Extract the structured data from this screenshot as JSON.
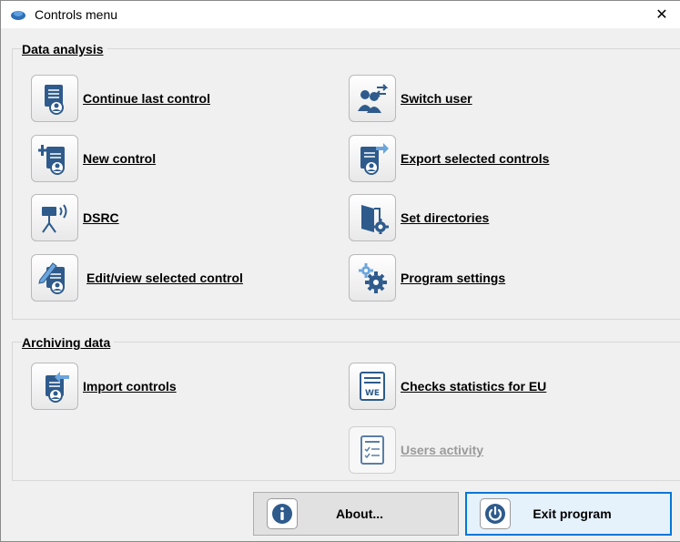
{
  "window": {
    "title": "Controls menu",
    "close_glyph": "✕"
  },
  "sections": {
    "data_analysis": "Data analysis",
    "archiving": "Archiving data"
  },
  "items": {
    "continue_last_control": {
      "label": "Continue last control",
      "icon": "document-user-icon"
    },
    "switch_user": {
      "label": "Switch user",
      "icon": "switch-user-icon"
    },
    "new_control": {
      "label": "New control",
      "icon": "new-document-icon"
    },
    "export_selected_controls": {
      "label": "Export selected controls",
      "icon": "export-document-icon"
    },
    "dsrc": {
      "label": "DSRC",
      "icon": "dsrc-antenna-icon"
    },
    "set_directories": {
      "label": "Set directories",
      "icon": "folder-gear-icon"
    },
    "edit_view_selected_control": {
      "label": "Edit/view selected control",
      "icon": "edit-document-icon"
    },
    "program_settings": {
      "label": "Program settings",
      "icon": "gears-icon"
    },
    "import_controls": {
      "label": "Import controls",
      "icon": "import-document-icon"
    },
    "checks_statistics_eu": {
      "label": "Checks statistics for EU",
      "icon": "we-document-icon",
      "badge": "WE"
    },
    "users_activity": {
      "label": "Users activity",
      "icon": "checklist-icon",
      "disabled": true
    }
  },
  "buttons": {
    "about": {
      "label": "About...",
      "icon": "info-icon"
    },
    "exit": {
      "label": "Exit program",
      "icon": "power-icon"
    }
  },
  "colors": {
    "icon_blue": "#2e5b8c",
    "exit_border": "#0078d7",
    "disabled_text": "#9a9a9a"
  }
}
